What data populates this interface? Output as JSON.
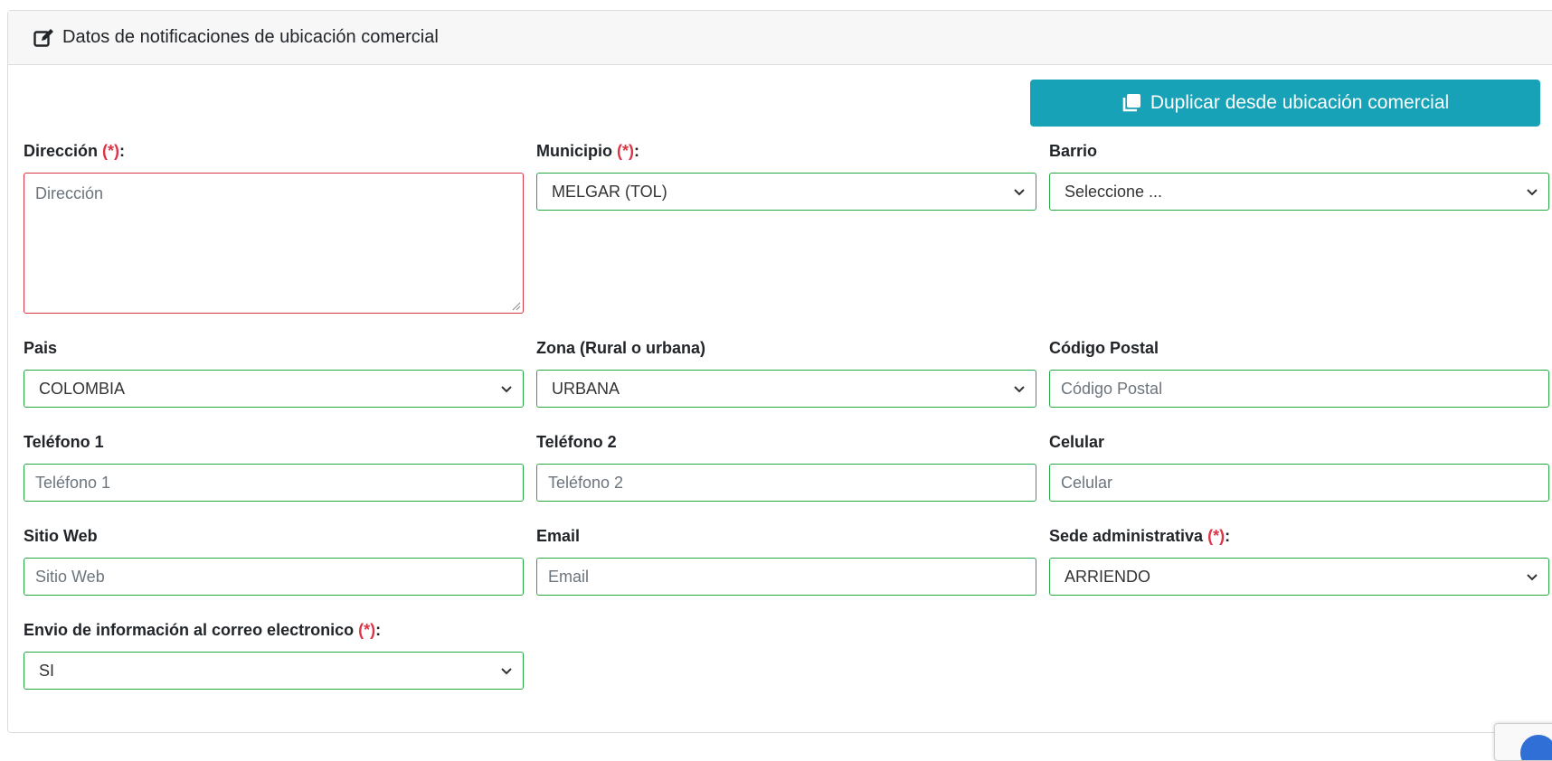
{
  "header": {
    "title": "Datos de notificaciones de ubicación comercial"
  },
  "duplicate_button": {
    "label": "Duplicar desde ubicación comercial"
  },
  "required_mark": "(*)",
  "fields": {
    "direccion": {
      "label": "Dirección",
      "suffix": ":",
      "placeholder": "Dirección",
      "value": ""
    },
    "municipio": {
      "label": "Municipio",
      "suffix": ":",
      "value": "MELGAR (TOL)"
    },
    "barrio": {
      "label": "Barrio",
      "value": "Seleccione ..."
    },
    "pais": {
      "label": "Pais",
      "value": "COLOMBIA"
    },
    "zona": {
      "label": "Zona (Rural o urbana)",
      "value": "URBANA"
    },
    "codigo_postal": {
      "label": "Código Postal",
      "placeholder": "Código Postal",
      "value": ""
    },
    "telefono1": {
      "label": "Teléfono 1",
      "placeholder": "Teléfono 1",
      "value": ""
    },
    "telefono2": {
      "label": "Teléfono 2",
      "placeholder": "Teléfono 2",
      "value": ""
    },
    "celular": {
      "label": "Celular",
      "placeholder": "Celular",
      "value": ""
    },
    "sitio_web": {
      "label": "Sitio Web",
      "placeholder": "Sitio Web",
      "value": ""
    },
    "email": {
      "label": "Email",
      "placeholder": "Email",
      "value": ""
    },
    "sede": {
      "label": "Sede administrativa",
      "suffix": ":",
      "value": "ARRIENDO"
    },
    "envio_correo": {
      "label": "Envio de información al correo electronico",
      "suffix": ":",
      "value": "SI"
    }
  },
  "colors": {
    "accent": "#17a2b8",
    "valid_border": "#28a745",
    "invalid_border": "#dc3545",
    "required": "#dc3545"
  }
}
